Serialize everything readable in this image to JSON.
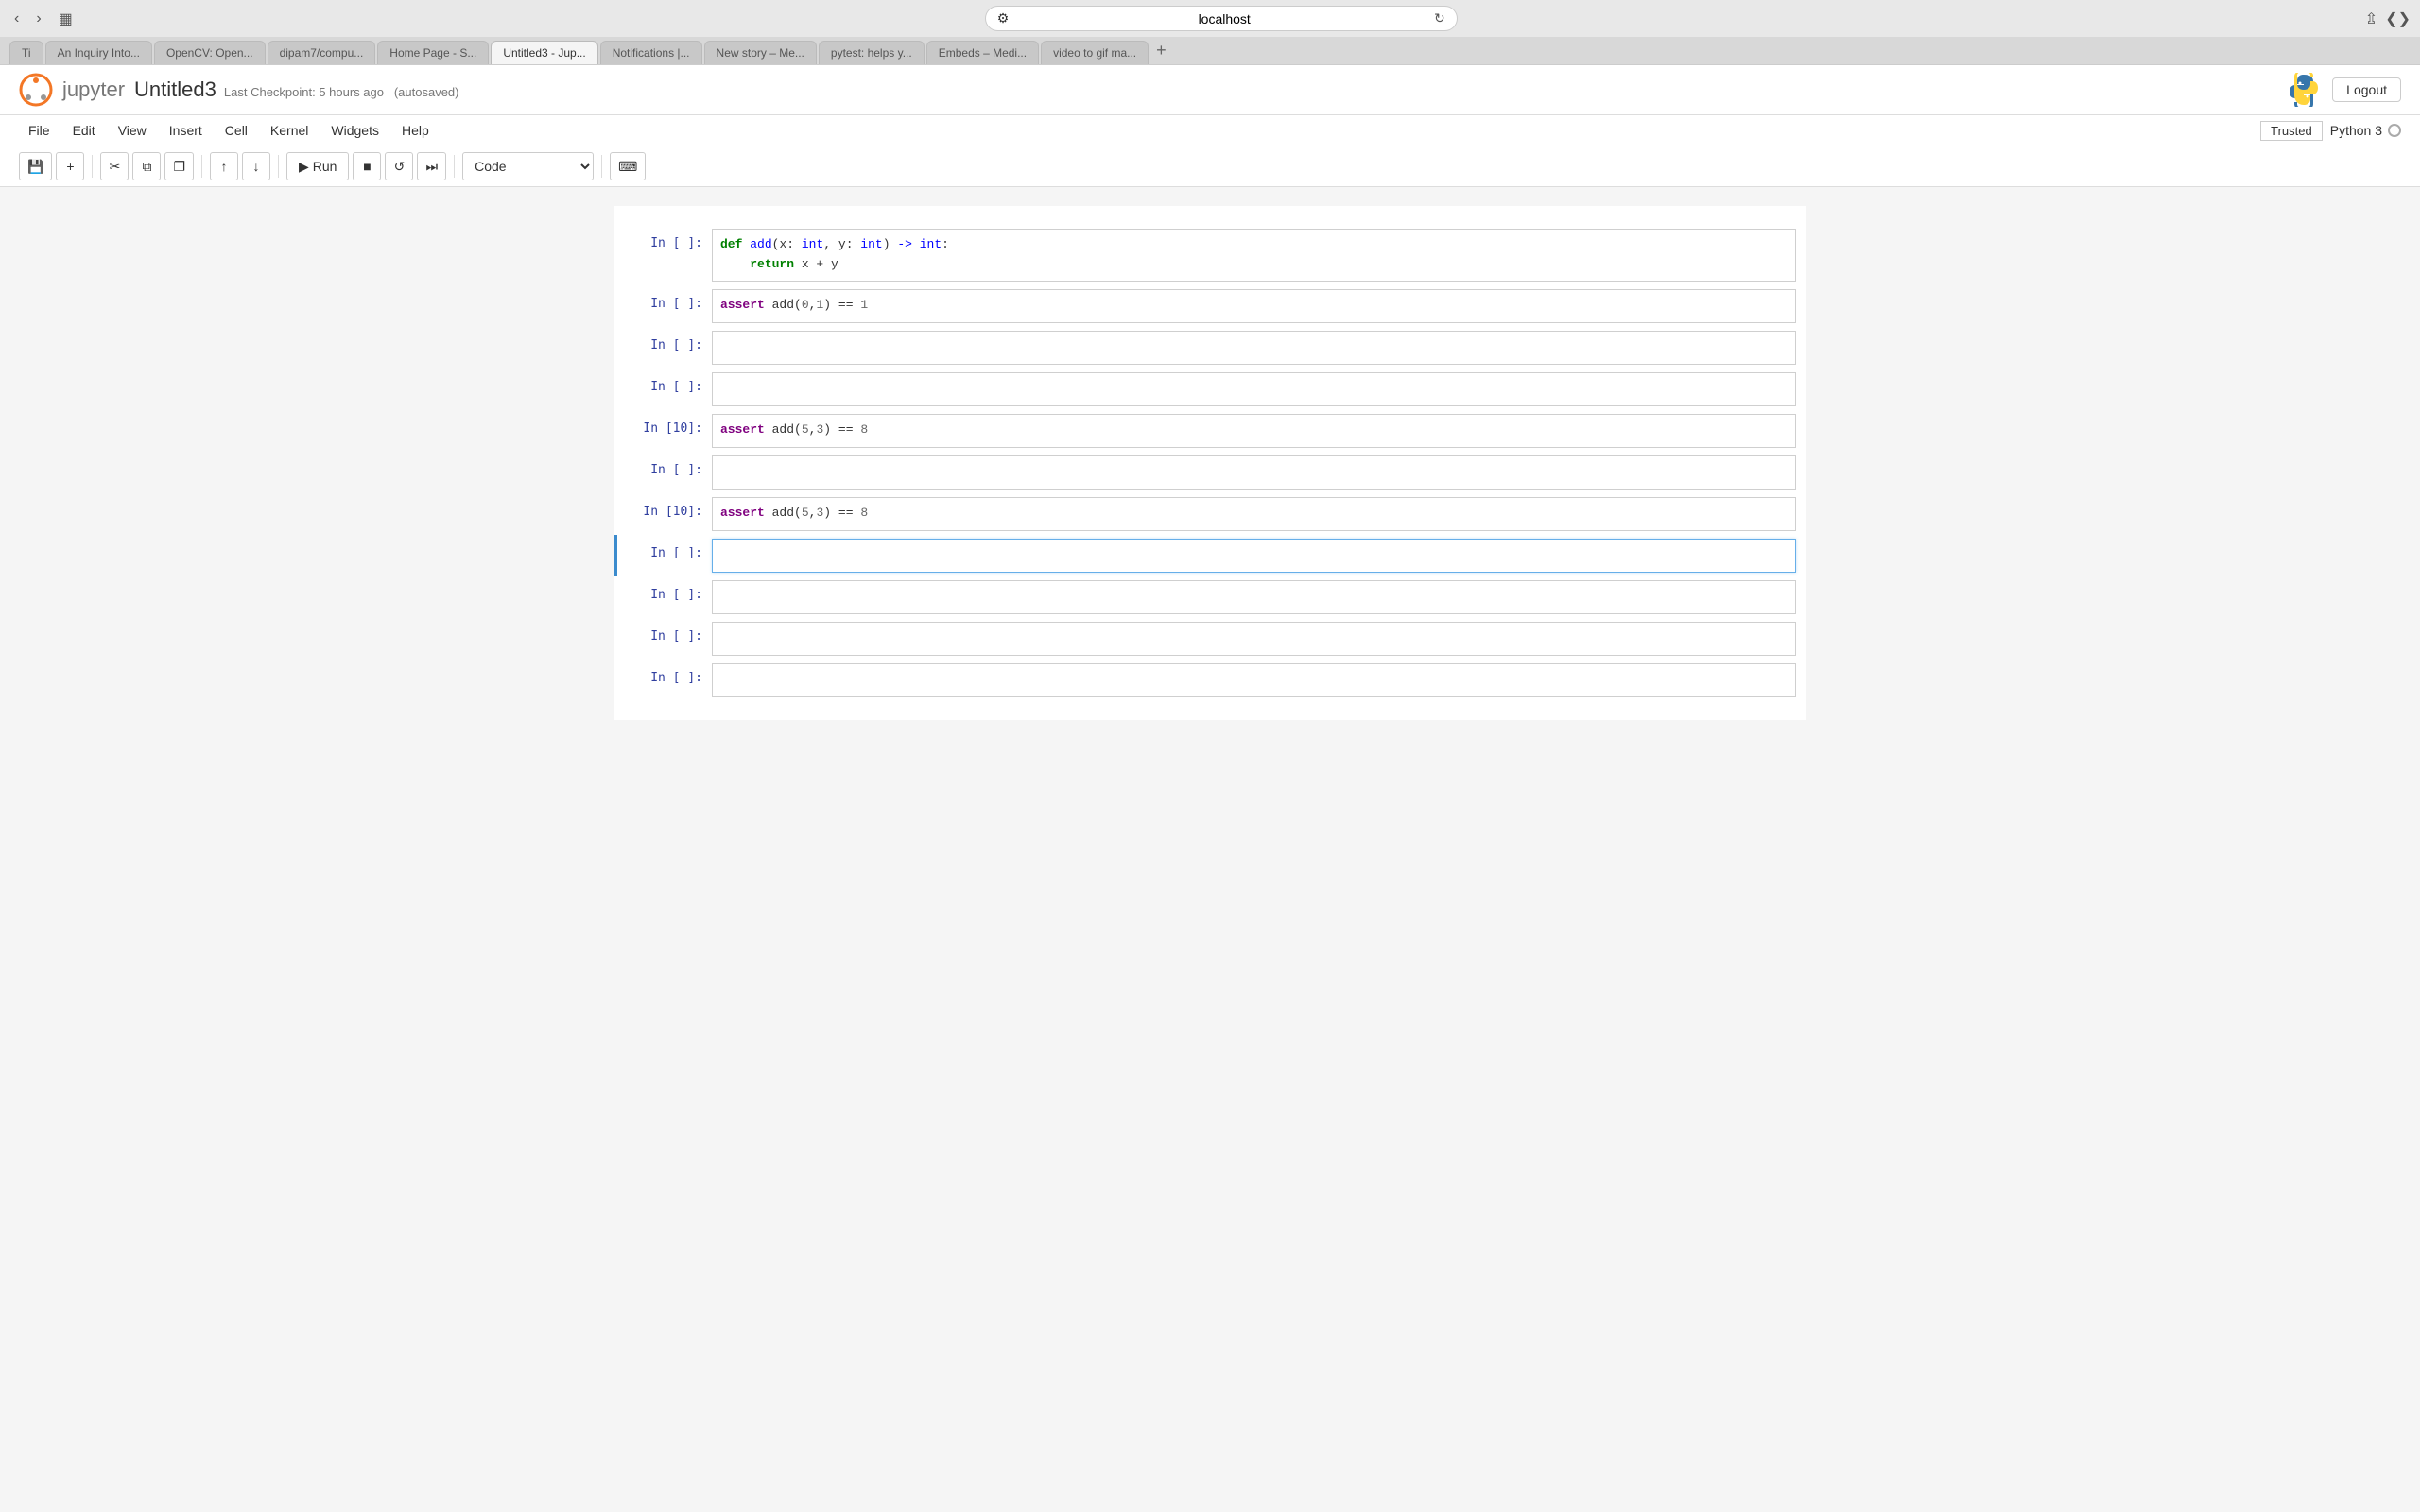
{
  "browser": {
    "address": "localhost",
    "tabs": [
      {
        "label": "Ti",
        "active": false
      },
      {
        "label": "An Inquiry Into...",
        "active": false
      },
      {
        "label": "OpenCV: Open...",
        "active": false
      },
      {
        "label": "dipam7/compu...",
        "active": false
      },
      {
        "label": "Home Page - S...",
        "active": false
      },
      {
        "label": "Untitled3 - Jup...",
        "active": true
      },
      {
        "label": "Notifications |...",
        "active": false
      },
      {
        "label": "New story - Me...",
        "active": false
      },
      {
        "label": "pytest: helps y...",
        "active": false
      },
      {
        "label": "Embeds - Medi...",
        "active": false
      },
      {
        "label": "video to gif ma...",
        "active": false
      }
    ],
    "new_tab_label": "+"
  },
  "header": {
    "notebook_title": "Untitled3",
    "checkpoint_text": "Last Checkpoint: 5 hours ago",
    "autosaved_text": "(autosaved)",
    "logout_label": "Logout"
  },
  "menu": {
    "items": [
      "File",
      "Edit",
      "View",
      "Insert",
      "Cell",
      "Kernel",
      "Widgets",
      "Help"
    ],
    "trusted_label": "Trusted",
    "kernel_label": "Python 3"
  },
  "toolbar": {
    "save_icon": "💾",
    "add_icon": "+",
    "cut_icon": "✂",
    "copy_icon": "⧉",
    "paste_icon": "⬦",
    "move_up_icon": "↑",
    "move_down_icon": "↓",
    "run_label": "Run",
    "stop_icon": "■",
    "restart_icon": "↺",
    "fast_forward_icon": "⏭",
    "cell_type": "Code",
    "keyboard_icon": "⌨"
  },
  "cells": [
    {
      "id": "cell-1",
      "prompt": "In [ ]:",
      "content": "def add(x: int, y: int) -> int:\n    return x + y",
      "type": "code",
      "active": false
    },
    {
      "id": "cell-2",
      "prompt": "In [ ]:",
      "content": "assert add(0,1) == 1",
      "type": "code",
      "active": false
    },
    {
      "id": "cell-3",
      "prompt": "In [ ]:",
      "content": "",
      "type": "code",
      "active": false
    },
    {
      "id": "cell-4",
      "prompt": "In [ ]:",
      "content": "",
      "type": "code",
      "active": false
    },
    {
      "id": "cell-5",
      "prompt": "In [10]:",
      "content": "assert add(5,3) == 8",
      "type": "code",
      "active": false
    },
    {
      "id": "cell-6",
      "prompt": "In [ ]:",
      "content": "",
      "type": "code",
      "active": false
    },
    {
      "id": "cell-7",
      "prompt": "In [10]:",
      "content": "assert add(5,3) == 8",
      "type": "code",
      "active": false
    },
    {
      "id": "cell-8",
      "prompt": "In [ ]:",
      "content": "",
      "type": "code",
      "active": true
    },
    {
      "id": "cell-9",
      "prompt": "In [ ]:",
      "content": "",
      "type": "code",
      "active": false
    },
    {
      "id": "cell-10",
      "prompt": "In [ ]:",
      "content": "",
      "type": "code",
      "active": false
    },
    {
      "id": "cell-11",
      "prompt": "In [ ]:",
      "content": "",
      "type": "code",
      "active": false
    }
  ]
}
